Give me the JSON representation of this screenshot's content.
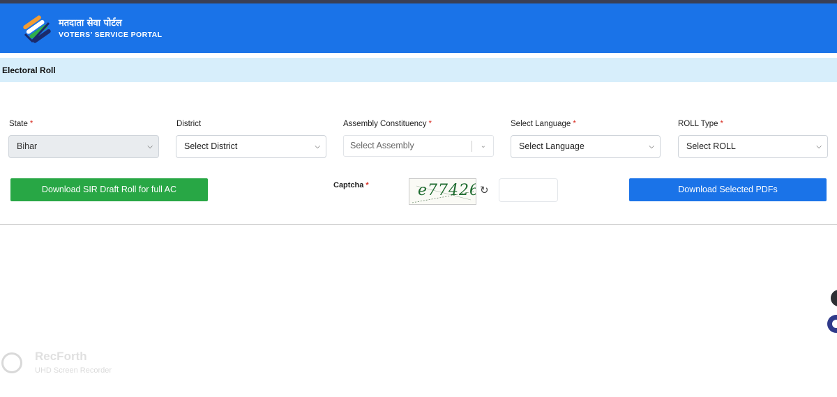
{
  "header": {
    "title_hindi": "मतदाता सेवा पोर्टल",
    "title_english": "VOTERS’ SERVICE PORTAL",
    "background": "#1a73e8"
  },
  "page": {
    "title": "Electoral Roll"
  },
  "form": {
    "state": {
      "label": "State",
      "required": "*",
      "value": "Bihar",
      "disabled": true
    },
    "district": {
      "label": "District",
      "value": "Select District"
    },
    "assembly": {
      "label": "Assembly Constituency",
      "required": "*",
      "placeholder": "Select Assembly"
    },
    "language": {
      "label": "Select Language",
      "required": "*",
      "value": "Select Language"
    },
    "roll_type": {
      "label": "ROLL Type",
      "required": "*",
      "value": "Select ROLL"
    },
    "captcha": {
      "label": "Captcha",
      "required": "*",
      "image_text": "e77426",
      "input_value": ""
    }
  },
  "buttons": {
    "download_full": "Download SIR Draft Roll for full AC",
    "download_selected": "Download Selected PDFs"
  },
  "colors": {
    "green_button": "#28a745",
    "blue_button": "#1a73e8",
    "title_bar": "#d7eefb",
    "required_mark": "#d93025"
  },
  "watermark": {
    "title": "RecForth",
    "subtitle": "UHD Screen Recorder"
  }
}
